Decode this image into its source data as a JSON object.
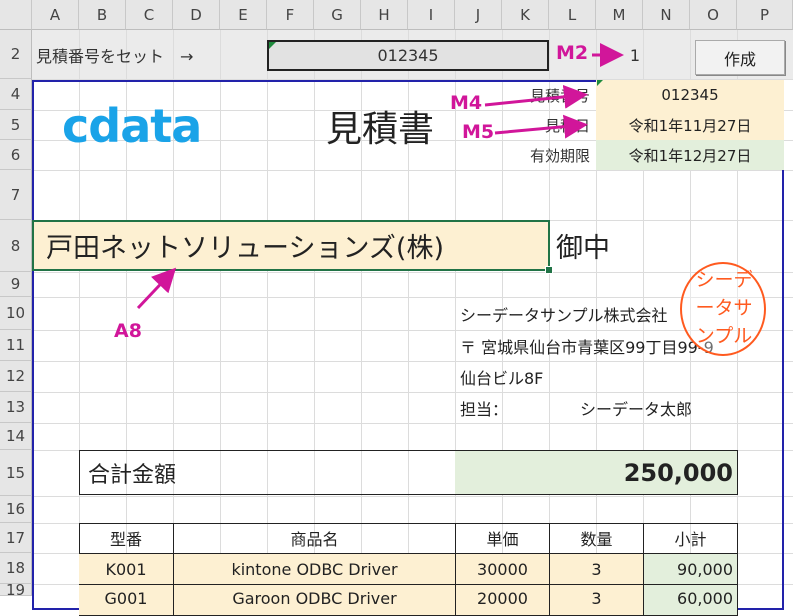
{
  "columns": [
    "A",
    "B",
    "C",
    "D",
    "E",
    "F",
    "G",
    "H",
    "I",
    "J",
    "K",
    "L",
    "M",
    "N",
    "O",
    "P"
  ],
  "rows": [
    "2",
    "4",
    "5",
    "6",
    "7",
    "8",
    "9",
    "10",
    "11",
    "12",
    "13",
    "14",
    "15",
    "16",
    "17",
    "18",
    "19"
  ],
  "row2": {
    "label": "見積番号をセット　→",
    "quote_input": "012345",
    "m2_value": "1",
    "create_button": "作成"
  },
  "header": {
    "logo_text": "cdata",
    "title": "見積書",
    "quote_no_label": "見積番号",
    "quote_no": "012345",
    "date_label": "見積日",
    "date": "令和1年11月27日",
    "expiry_label": "有効期限",
    "expiry": "令和1年12月27日"
  },
  "customer": {
    "name": "戸田ネットソリューションズ(株)",
    "suffix": "御中"
  },
  "company": {
    "name": "シーデータサンプル株式会社",
    "address": "〒 宮城県仙台市青葉区99丁目99-9",
    "building": "仙台ビル8F",
    "rep_label": "担当：",
    "rep_name": "シーデータ太郎",
    "stamp": "シーデータサンプル"
  },
  "total": {
    "label": "合計金額",
    "value": "250,000"
  },
  "table": {
    "headers": [
      "型番",
      "商品名",
      "単価",
      "数量",
      "小計"
    ],
    "rows": [
      [
        "K001",
        "kintone ODBC Driver",
        "30000",
        "3",
        "90,000"
      ],
      [
        "G001",
        "Garoon ODBC Driver",
        "20000",
        "3",
        "60,000"
      ]
    ]
  },
  "annotations": {
    "m2": "M2",
    "m4": "M4",
    "m5": "M5",
    "a8": "A8"
  },
  "colors": {
    "accent_border": "#2222aa",
    "highlight": "#fdf0d2",
    "green_fill": "#e3efdc",
    "annot": "#d1169a",
    "stamp": "#ff5a1f"
  }
}
